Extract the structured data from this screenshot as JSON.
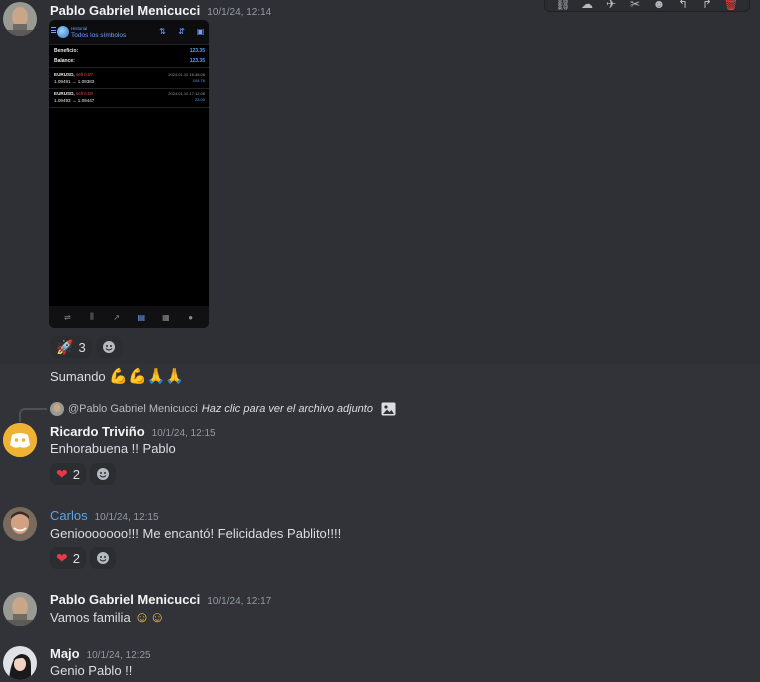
{
  "toolbar": {
    "actions": [
      {
        "icon": "link-icon",
        "glyph": "⛓"
      },
      {
        "icon": "thread-icon",
        "glyph": "☁"
      },
      {
        "icon": "pin-icon",
        "glyph": "✈"
      },
      {
        "icon": "tag-icon",
        "glyph": "✂"
      },
      {
        "icon": "emoji-icon",
        "glyph": "☻"
      },
      {
        "icon": "reply-icon",
        "glyph": "↰"
      },
      {
        "icon": "forward-icon",
        "glyph": "↱"
      },
      {
        "icon": "trash-icon",
        "glyph": "🗑"
      }
    ]
  },
  "messages": [
    {
      "author": "Pablo Gabriel Menicucci",
      "timestamp": "10/1/24, 12:14",
      "attachment": {
        "subtitle": "Historial",
        "title": "Todos los símbolos",
        "summary": [
          {
            "label": "Beneficio:",
            "value": "123.35"
          },
          {
            "label": "Balance:",
            "value": "123.35"
          }
        ],
        "trades": [
          {
            "symbol": "EURUSD,",
            "side": "sell 0.97",
            "prices": "1.09491 → 1.09383",
            "date": "2024.01.10 16:38:08",
            "profit": "104.76"
          },
          {
            "symbol": "EURUSD,",
            "side": "sell 0.50",
            "prices": "1.09493 → 1.09447",
            "date": "2024.01.10 17:12:08",
            "profit": "23.00"
          }
        ]
      },
      "reactions": [
        {
          "emoji": "🚀",
          "count": "3"
        }
      ]
    },
    {
      "continuation": "Sumando",
      "emoji": "💪💪🙏🙏"
    },
    {
      "reply": {
        "mention": "@Pablo Gabriel Menicucci",
        "hint": "Haz clic para ver el archivo adjunto"
      },
      "author": "Ricardo Triviño",
      "timestamp": "10/1/24, 12:15",
      "text": "Enhorabuena !! Pablo",
      "reactions": [
        {
          "emoji": "❤",
          "count": "2"
        }
      ]
    },
    {
      "author": "Carlos",
      "timestamp": "10/1/24, 12:15",
      "text": "Geniooooooo!!! Me encantó! Felicidades Pablito!!!!",
      "reactions": [
        {
          "emoji": "❤",
          "count": "2"
        }
      ]
    },
    {
      "author": "Pablo Gabriel Menicucci",
      "timestamp": "10/1/24, 12:17",
      "text": "Vamos familia",
      "emoji": "☺☺"
    },
    {
      "author": "Majo",
      "timestamp": "10/1/24, 12:25",
      "text": "Genio Pablo !!"
    }
  ],
  "colors": {
    "background": "#313338",
    "hover": "#2e3035",
    "link_author": "#5aa5e8",
    "danger": "#f23f42",
    "mt_blue": "#6fa0ff"
  }
}
